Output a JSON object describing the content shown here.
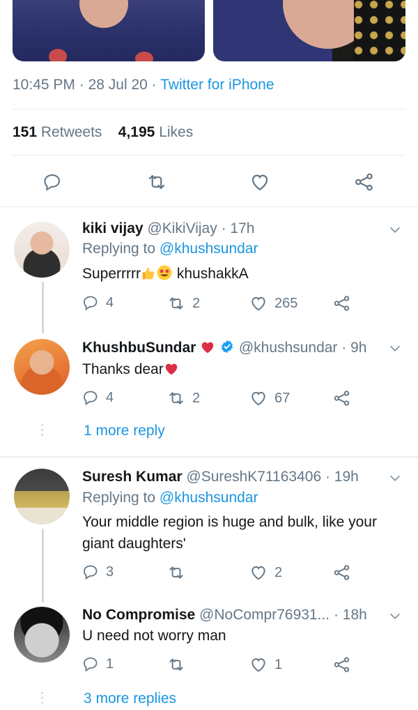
{
  "tweet_meta": {
    "time": "10:45 PM",
    "date": "28 Jul 20",
    "source": "Twitter for iPhone",
    "sep": "·"
  },
  "stats": {
    "retweets_count": "151",
    "retweets_label": "Retweets",
    "likes_count": "4,195",
    "likes_label": "Likes"
  },
  "replies": [
    {
      "name": "kiki vijay",
      "handle": "@KikiVijay",
      "time": "· 17h",
      "replying_label": "Replying to",
      "replying_to": "@khushsundar",
      "text_before": "Superrrrr",
      "text_after": " khushakkA",
      "reply_count": "4",
      "retweet_count": "2",
      "like_count": "265"
    },
    {
      "name": "KhushbuSundar",
      "handle": "@khushsundar",
      "time": "· 9h",
      "text": "Thanks dear",
      "reply_count": "4",
      "retweet_count": "2",
      "like_count": "67",
      "more_replies": "1 more reply"
    },
    {
      "name": "Suresh Kumar",
      "handle": "@SureshK71163406",
      "time": "· 19h",
      "replying_label": "Replying to",
      "replying_to": "@khushsundar",
      "text_line1": "Your middle region is huge and bulk, like your",
      "text_line2": "giant daughters'",
      "reply_count": "3",
      "retweet_count": "",
      "like_count": "2"
    },
    {
      "name": "No Compromise",
      "handle": "@NoCompr76931...",
      "time": "· 18h",
      "text": "U need not worry man",
      "reply_count": "1",
      "retweet_count": "",
      "like_count": "1",
      "more_replies": "3 more replies"
    }
  ],
  "colors": {
    "link": "#1b95e0",
    "muted": "#657786",
    "heart": "#e0245e",
    "verified": "#1da1f2"
  },
  "icons": [
    "reply-icon",
    "retweet-icon",
    "like-icon",
    "share-icon",
    "chevron-down-icon",
    "verified-badge-icon",
    "heart-emoji",
    "thumbs-up-emoji",
    "star-eyes-emoji"
  ]
}
